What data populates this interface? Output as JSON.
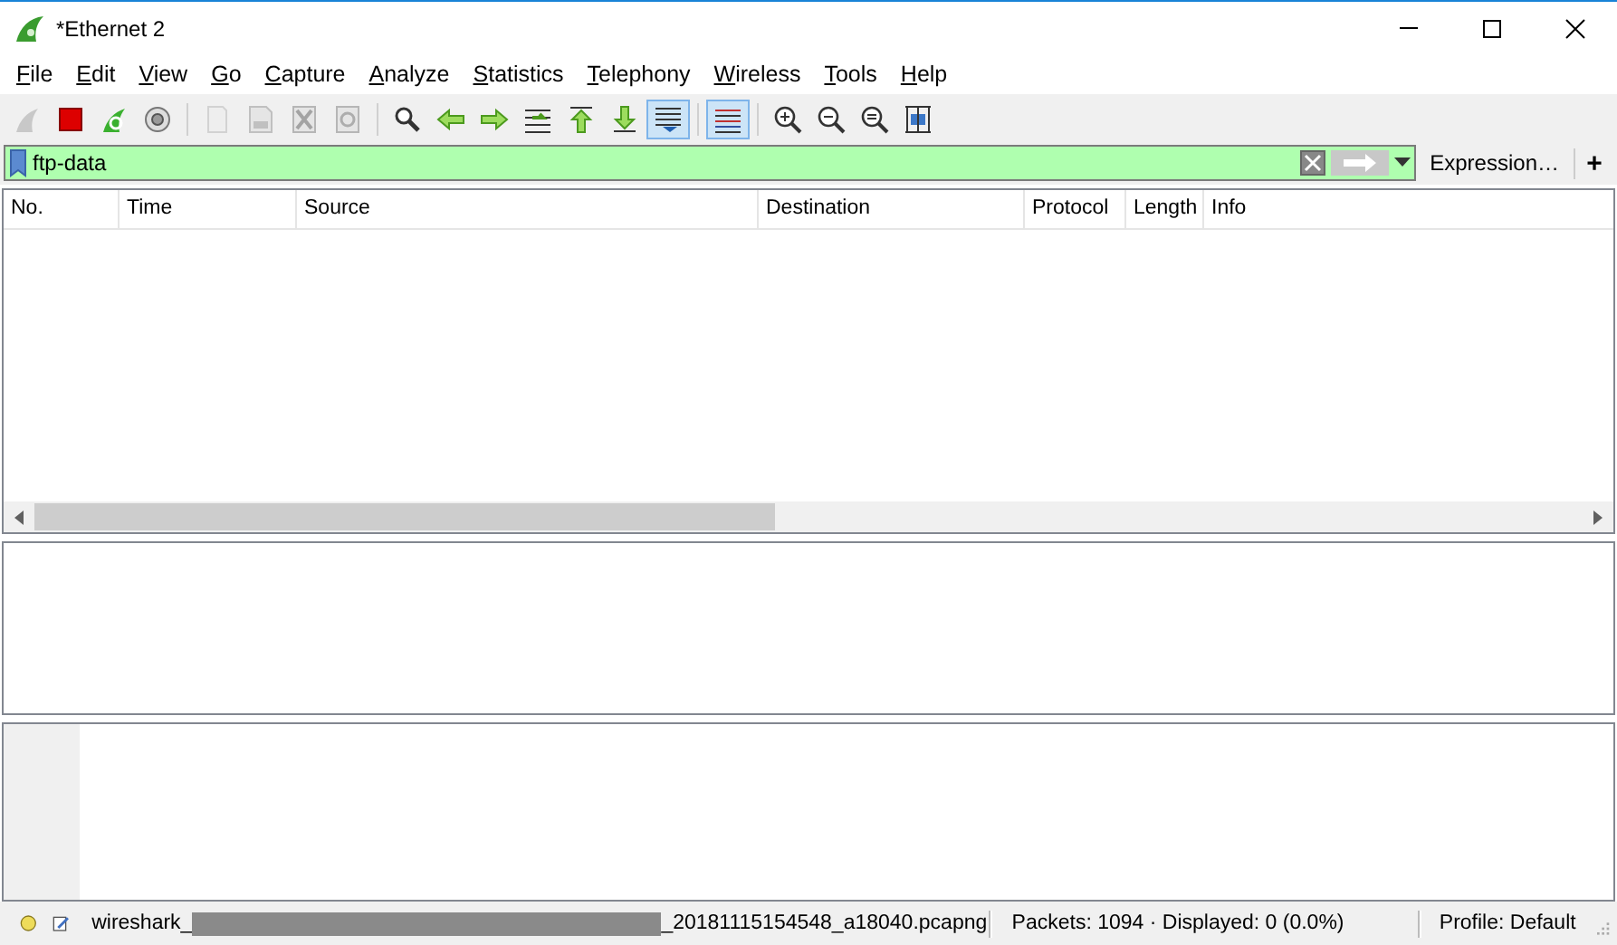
{
  "window": {
    "title": "*Ethernet 2"
  },
  "menu": [
    "File",
    "Edit",
    "View",
    "Go",
    "Capture",
    "Analyze",
    "Statistics",
    "Telephony",
    "Wireless",
    "Tools",
    "Help"
  ],
  "toolbar": [
    [
      {
        "kind": "start",
        "disabled": true,
        "toggled": false
      },
      {
        "kind": "stop",
        "disabled": false,
        "toggled": false
      },
      {
        "kind": "restart",
        "disabled": false,
        "toggled": false
      },
      {
        "kind": "options",
        "disabled": false,
        "toggled": false
      }
    ],
    [
      {
        "kind": "open",
        "disabled": true,
        "toggled": false
      },
      {
        "kind": "save",
        "disabled": true,
        "toggled": false
      },
      {
        "kind": "close",
        "disabled": true,
        "toggled": false
      },
      {
        "kind": "reload",
        "disabled": true,
        "toggled": false
      }
    ],
    [
      {
        "kind": "find",
        "disabled": false,
        "toggled": false
      },
      {
        "kind": "back",
        "disabled": false,
        "toggled": false
      },
      {
        "kind": "forward",
        "disabled": false,
        "toggled": false
      },
      {
        "kind": "goto",
        "disabled": false,
        "toggled": false
      },
      {
        "kind": "first",
        "disabled": false,
        "toggled": false
      },
      {
        "kind": "last",
        "disabled": false,
        "toggled": false
      },
      {
        "kind": "autoscroll",
        "disabled": false,
        "toggled": true
      }
    ],
    [
      {
        "kind": "colorize",
        "disabled": false,
        "toggled": true
      }
    ],
    [
      {
        "kind": "zoomin",
        "disabled": false,
        "toggled": false
      },
      {
        "kind": "zoomout",
        "disabled": false,
        "toggled": false
      },
      {
        "kind": "zoomnormal",
        "disabled": false,
        "toggled": false
      },
      {
        "kind": "resize",
        "disabled": false,
        "toggled": false
      }
    ]
  ],
  "filter": {
    "value": "ftp-data",
    "valid": true,
    "expression_button": "Expression…",
    "add_button": "+"
  },
  "packet_list": {
    "columns": [
      "No.",
      "Time",
      "Source",
      "Destination",
      "Protocol",
      "Length",
      "Info"
    ]
  },
  "status_bar": {
    "file_start": "wireshark_",
    "file_end": "_20181115154548_a18040.pcapng",
    "packets": "Packets: 1094 · Displayed: 0 (0.0%)",
    "profile": "Profile: Default"
  }
}
